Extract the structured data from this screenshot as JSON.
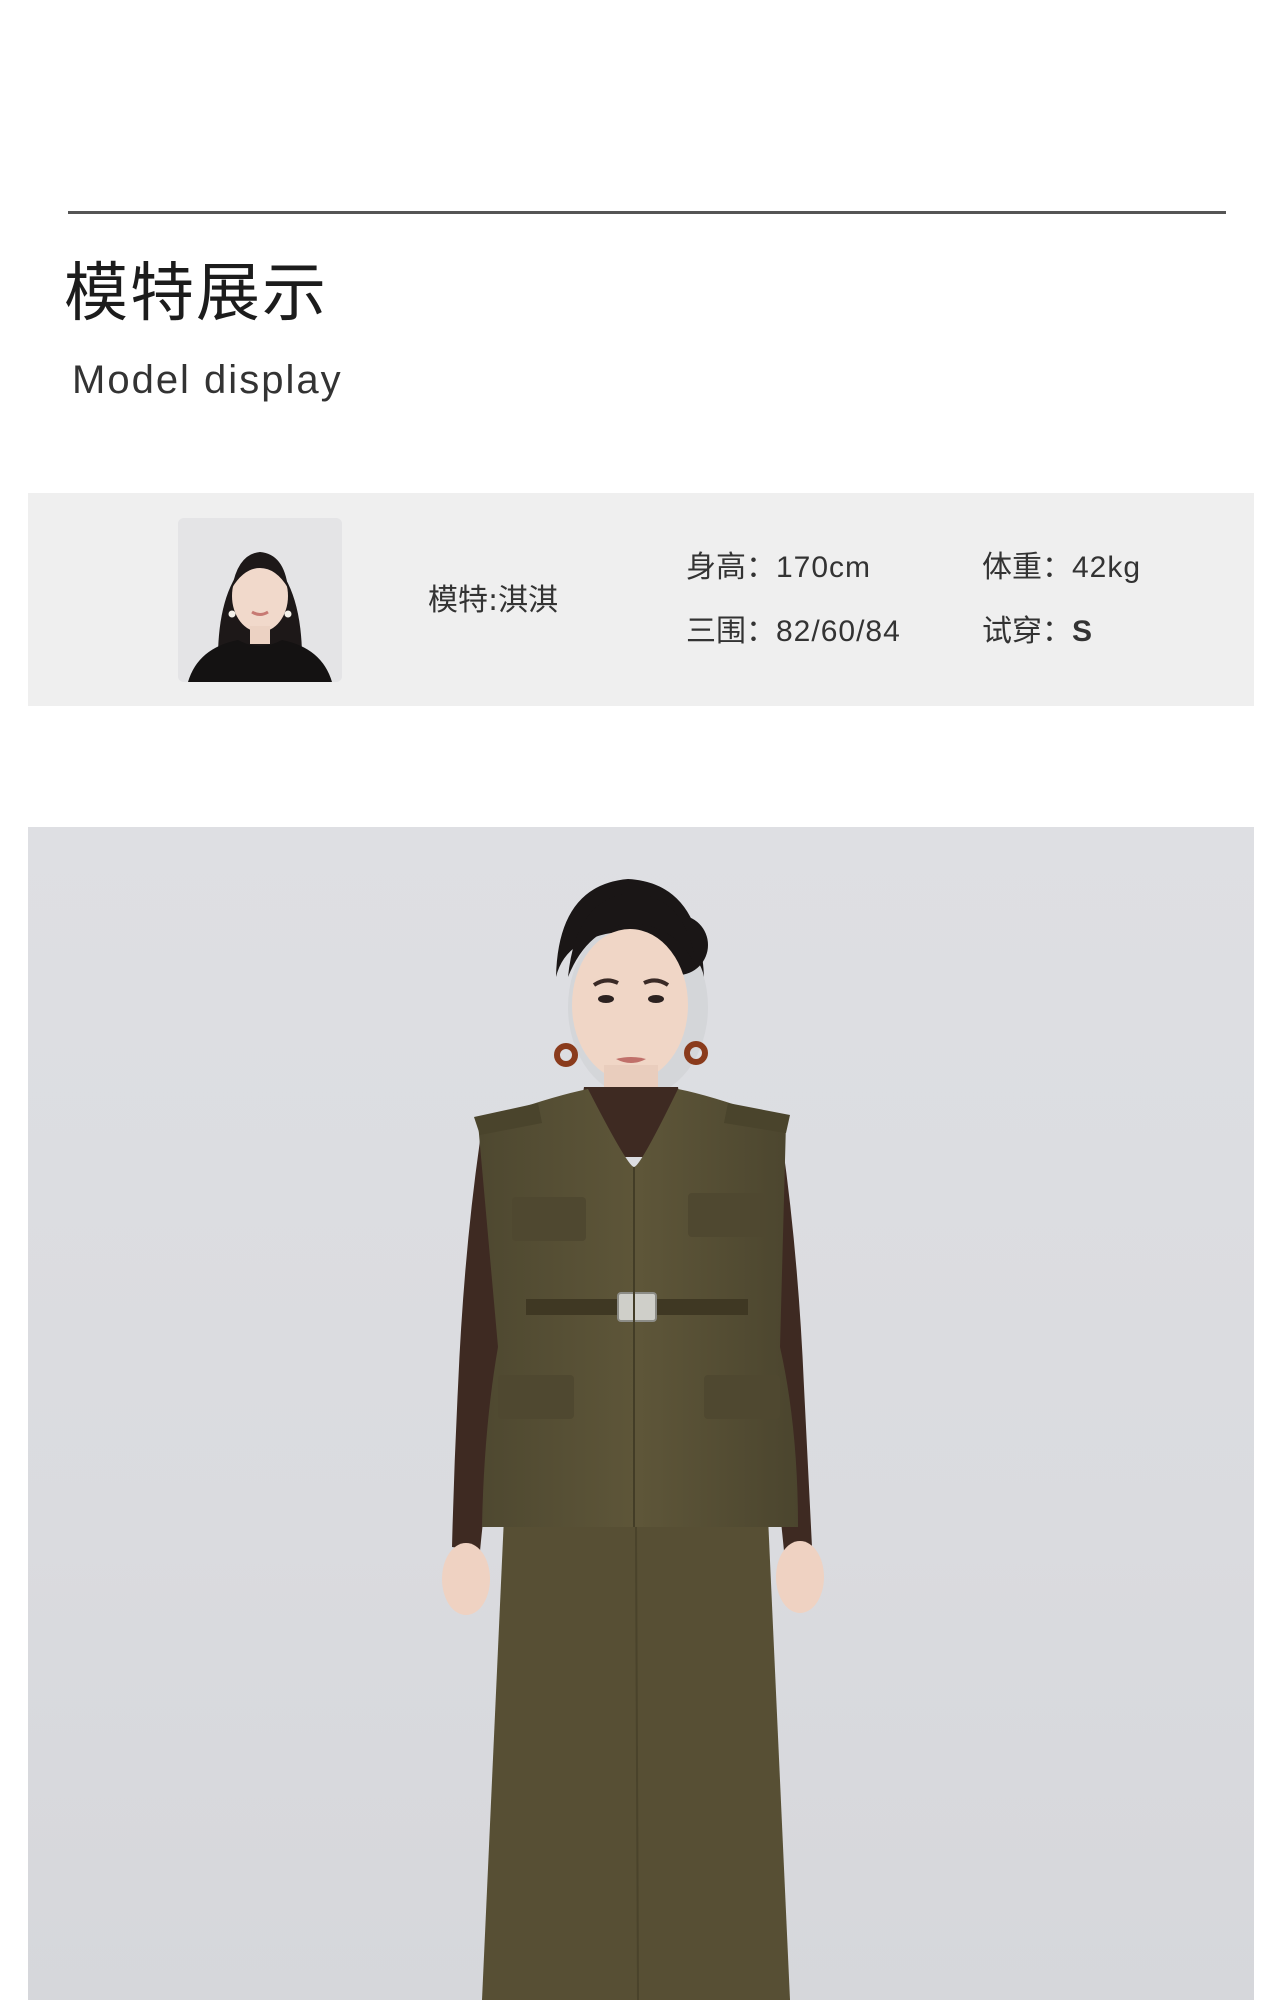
{
  "header": {
    "title_cn": "模特展示",
    "title_en": "Model display"
  },
  "model": {
    "name_text": "模特:淇淇",
    "height_label": "身高：",
    "height_value": "170cm",
    "weight_label": "体重：",
    "weight_value": "42kg",
    "measurements_label": "三围：",
    "measurements_value": "82/60/84",
    "size_label": "试穿：",
    "size_value": "S"
  },
  "colors": {
    "rule": "#555555",
    "info_bar_bg": "#efefef",
    "photo_bg": "#dcdde1",
    "vest": "#5a5236",
    "turtleneck": "#3e2a22",
    "skin": "#f0d6c6",
    "hair": "#1a1616"
  }
}
